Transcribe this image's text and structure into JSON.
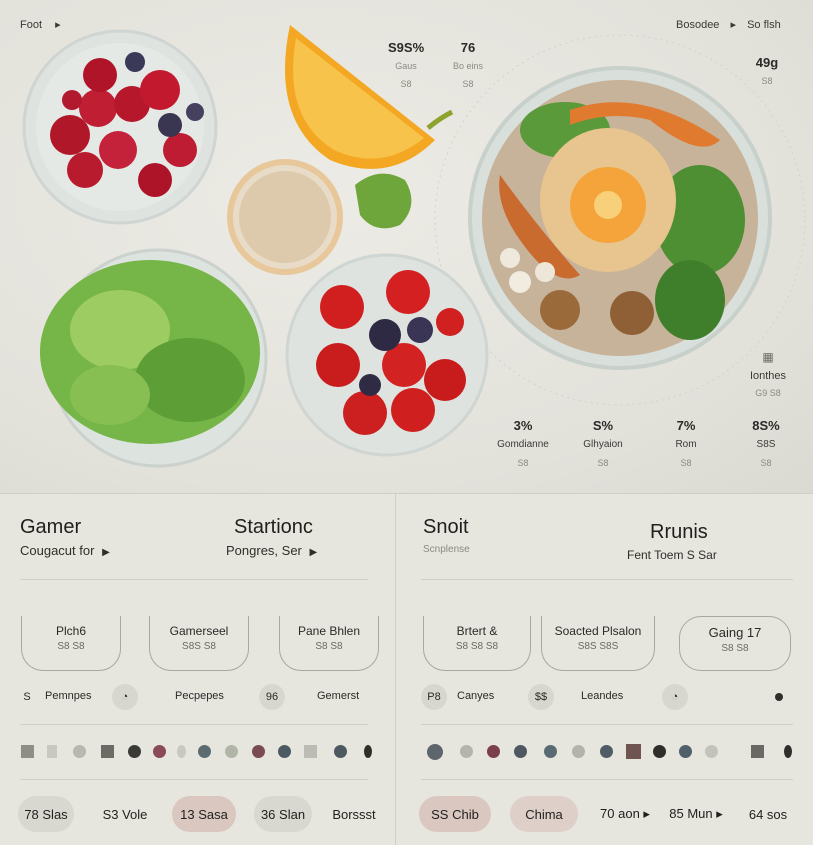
{
  "hero": {
    "top_left": {
      "label": "Foot",
      "arrow": "▸"
    },
    "top_right": {
      "label1": "Bosodee",
      "arrow": "▸",
      "label2": "So flsh"
    },
    "stat_a": {
      "value": "S9S%",
      "sub1": "Gaus",
      "sub2": "S8"
    },
    "stat_b": {
      "value": "76",
      "sub1": "Bo eins",
      "sub2": "S8"
    },
    "stat_c": {
      "value": "49g",
      "sub1": "S8"
    },
    "side_icon": {
      "label": "Ionthes",
      "sub": "G9 S8"
    },
    "metrics": [
      {
        "value": "3%",
        "label": "Gomdianne",
        "sub": "S8"
      },
      {
        "value": "S%",
        "label": "Glhyaion",
        "sub": "S8"
      },
      {
        "value": "7%",
        "label": "Rom",
        "sub": "S8"
      },
      {
        "value": "8S%",
        "label": "S8S",
        "sub": "S8"
      }
    ]
  },
  "left": {
    "title1": "Gamer",
    "sub1": "Cougacut for",
    "title2": "Startionc",
    "sub2": "Pongres, Ser",
    "cards": [
      {
        "title": "Plch6",
        "sub": "S8 S8"
      },
      {
        "title": "Gamerseel",
        "sub": "S8S S8"
      },
      {
        "title": "Pane Bhlen",
        "sub": "S8 S8"
      }
    ],
    "chips": [
      {
        "icon": "S",
        "label": "Pemnpes"
      },
      {
        "icon": "◔",
        "label": "Pecpepes"
      },
      {
        "icon": "96",
        "label": "Gemerst"
      }
    ],
    "pills": [
      {
        "label": "78 Slas"
      },
      {
        "label": "S3 Vole"
      },
      {
        "label": "13 Sasa"
      },
      {
        "label": "36 Slan"
      },
      {
        "label": "Borssst"
      }
    ]
  },
  "right": {
    "title1": "Snoit",
    "sub1": "Scnplense",
    "title2": "Rrunis",
    "sub2": "Fent  Toem S Sar",
    "cards": [
      {
        "title": "Brtert &",
        "sub": "S8 S8 S8"
      },
      {
        "title": "Soacted Plsalon",
        "sub": "S8S S8S"
      },
      {
        "title": "Gaing 17",
        "sub": "S8 S8"
      }
    ],
    "chips": [
      {
        "icon": "P8",
        "label": "Canyes"
      },
      {
        "icon": "$$",
        "label": "Leandes"
      },
      {
        "icon": "◔",
        "label": ""
      }
    ],
    "pills": [
      {
        "label": "SS Chib"
      },
      {
        "label": "Chima"
      },
      {
        "label": "70 aon ▸"
      },
      {
        "label": "85 Mun ▸"
      },
      {
        "label": "64 sos"
      }
    ]
  },
  "colors": {
    "bg": "#e4e3dc",
    "card_border": "#a9a8a0",
    "pill_accent": "#d9c7c0",
    "text": "#2a2a28"
  }
}
